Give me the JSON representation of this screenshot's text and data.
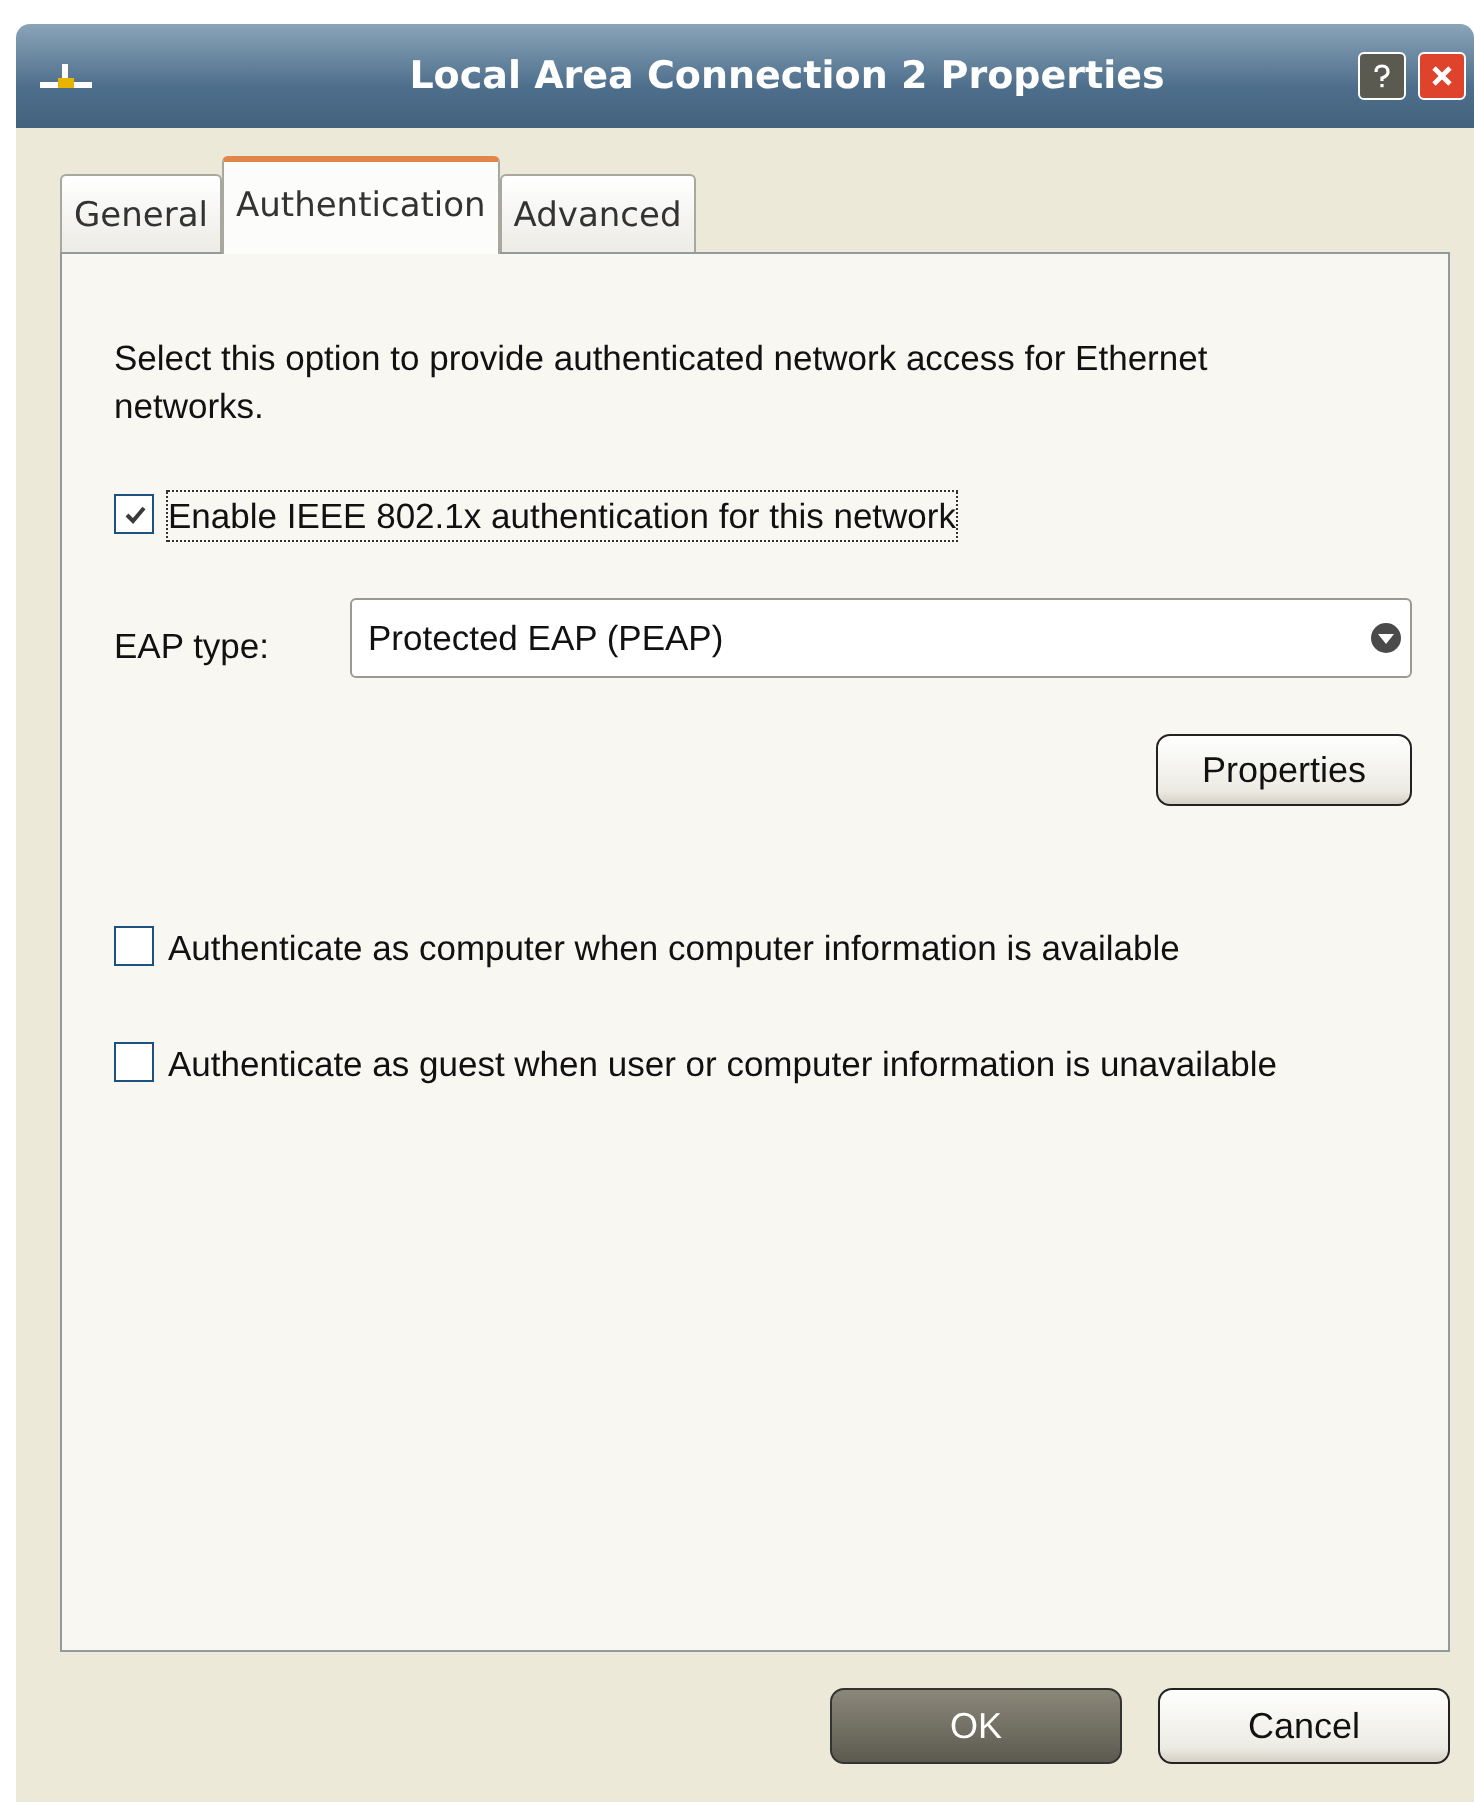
{
  "window": {
    "title": "Local Area Connection 2 Properties"
  },
  "tabs": [
    {
      "label": "General",
      "selected": false
    },
    {
      "label": "Authentication",
      "selected": true
    },
    {
      "label": "Advanced",
      "selected": false
    }
  ],
  "description": "Select this option to provide authenticated network access for Ethernet networks.",
  "options": [
    {
      "kind": "checkbox",
      "label": "Enable IEEE 802.1x authentication for this network",
      "checked": true,
      "focused": true
    },
    {
      "kind": "select",
      "label": "EAP type:",
      "value": "Protected EAP (PEAP)"
    },
    {
      "kind": "button",
      "label": "Properties"
    },
    {
      "kind": "checkbox",
      "label": "Authenticate as computer when computer information is available",
      "checked": false,
      "focused": false
    },
    {
      "kind": "checkbox",
      "label": "Authenticate as guest when user or computer information is unavailable",
      "checked": false,
      "focused": false
    }
  ],
  "buttons": [
    {
      "label": "OK",
      "default": true
    },
    {
      "label": "Cancel",
      "default": false
    }
  ]
}
